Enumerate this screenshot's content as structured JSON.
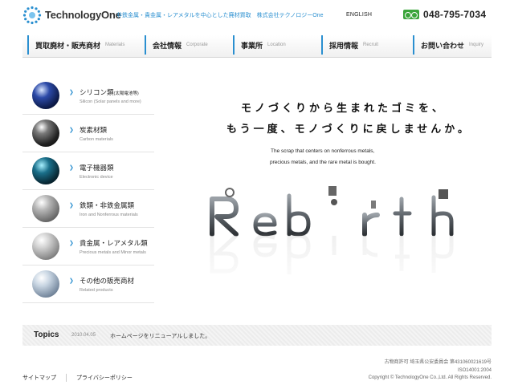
{
  "header": {
    "logo_text": "TechnologyOne",
    "tagline": "非鉄金属・貴金属・レアメタルを中心とした廃材買取　株式会社テクノロジーOne",
    "language_link": "ENGLISH",
    "phone": "048-795-7034",
    "accent_color": "#2a8fd0"
  },
  "nav": {
    "items": [
      {
        "jp": "買取廃材・販売商材",
        "en": "Materials"
      },
      {
        "jp": "会社情報",
        "en": "Corporate"
      },
      {
        "jp": "事業所",
        "en": "Location"
      },
      {
        "jp": "採用情報",
        "en": "Recruit"
      },
      {
        "jp": "お問い合わせ",
        "en": "Inquiry"
      }
    ]
  },
  "sidebar": {
    "items": [
      {
        "jp": "シリコン類",
        "jp_small": "(太陽電池等)",
        "en": "Silicon (Solar panels and more)"
      },
      {
        "jp": "炭素材類",
        "en": "Carbon materials"
      },
      {
        "jp": "電子機器類",
        "en": "Electronic device"
      },
      {
        "jp": "鉄類・非鉄金属類",
        "en": "Iron and Nonferrous materials"
      },
      {
        "jp": "貴金属・レアメタル類",
        "en": "Precious metals and Minor metals"
      },
      {
        "jp": "その他の販売商材",
        "en": "Related products"
      }
    ]
  },
  "hero": {
    "jp_line1": "モノづくりから生まれたゴミを、",
    "jp_line2": "もう一度、モノづくりに戻しませんか。",
    "en_line1": "The scrap that centers on nonferrous metals,",
    "en_line2": "precious metals, and the rare metal is bought.",
    "image_word": "Rebirth"
  },
  "topics": {
    "label": "Topics",
    "date": "2010.04.05",
    "text": "ホームページをリニューアルしました。"
  },
  "footer": {
    "links": [
      "サイトマップ",
      "プライバシーポリシー"
    ],
    "license": "古物商許可 埼玉県公安委員会 第431060021619号",
    "iso": "ISO14001:2004",
    "copyright": "Copyright © TechnologyOne Co.,Ltd. All Rights Reserved."
  }
}
